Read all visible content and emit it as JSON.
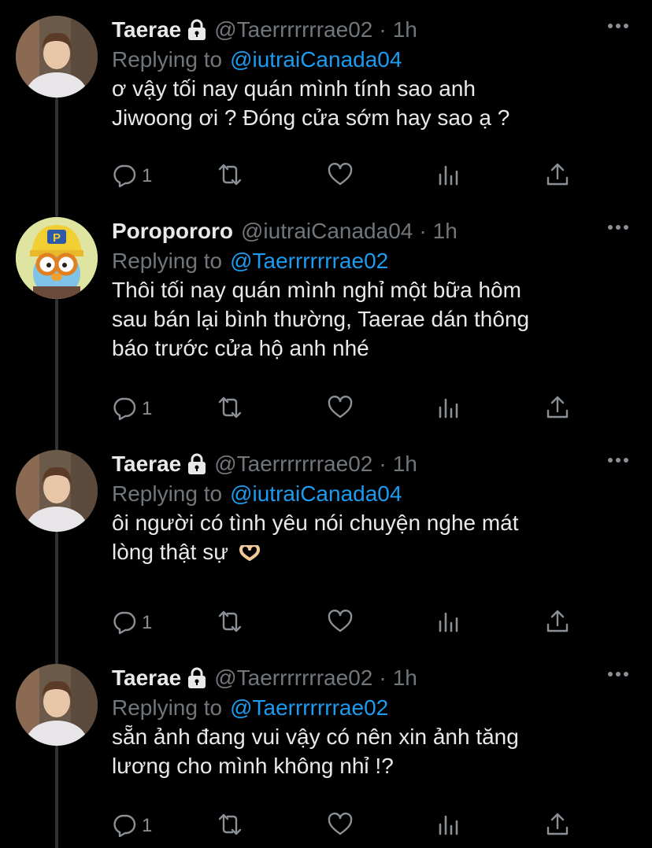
{
  "thread": [
    {
      "name": "Taerae",
      "locked": true,
      "handle": "@Taerrrrrrrae02",
      "sep": "·",
      "time": "1h",
      "reply_prefix": "Replying to",
      "reply_to": "@iutraiCanada04",
      "text_lines": [
        "ơ vậy tối nay quán mình tính sao anh",
        "Jiwoong ơi ? Đóng cửa sớm hay sao ạ ?"
      ],
      "reply_count": "1",
      "avatar": "taerae-avatar"
    },
    {
      "name": "Poropororo",
      "locked": false,
      "handle": "@iutraiCanada04",
      "sep": "·",
      "time": "1h",
      "reply_prefix": "Replying to",
      "reply_to": "@Taerrrrrrrae02",
      "text_lines": [
        "Thôi tối nay quán mình nghỉ một bữa hôm",
        "sau bán lại bình thường, Taerae dán thông",
        "báo trước cửa hộ anh nhé"
      ],
      "reply_count": "1",
      "avatar": "pororo-avatar"
    },
    {
      "name": "Taerae",
      "locked": true,
      "handle": "@Taerrrrrrrae02",
      "sep": "·",
      "time": "1h",
      "reply_prefix": "Replying to",
      "reply_to": "@iutraiCanada04",
      "text_lines": [
        "ôi người có tình yêu nói chuyện nghe mát",
        "lòng thật sự"
      ],
      "emoji": "heart-hands-emoji",
      "reply_count": "1",
      "avatar": "taerae-avatar"
    },
    {
      "name": "Taerae",
      "locked": true,
      "handle": "@Taerrrrrrrae02",
      "sep": "·",
      "time": "1h",
      "reply_prefix": "Replying to",
      "reply_to": "@Taerrrrrrrae02",
      "text_lines": [
        "sẵn ảnh đang vui vậy có nên xin ảnh tăng",
        "lương cho mình không nhỉ !?"
      ],
      "reply_count": "1",
      "avatar": "taerae-avatar"
    }
  ],
  "colors": {
    "background": "#000000",
    "text": "#e7e9ea",
    "muted": "#71767b",
    "link": "#1d9bf0",
    "thread_line": "#2f3336"
  },
  "icons": [
    "comment-icon",
    "retweet-icon",
    "like-icon",
    "analytics-icon",
    "share-icon",
    "more-icon",
    "lock-icon"
  ]
}
